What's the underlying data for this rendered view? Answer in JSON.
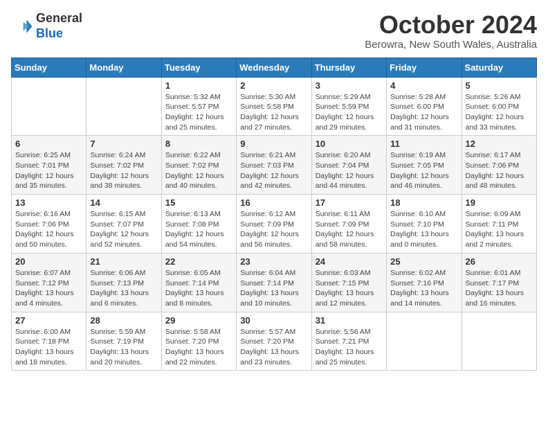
{
  "header": {
    "logo_general": "General",
    "logo_blue": "Blue",
    "title": "October 2024",
    "location": "Berowra, New South Wales, Australia"
  },
  "days_of_week": [
    "Sunday",
    "Monday",
    "Tuesday",
    "Wednesday",
    "Thursday",
    "Friday",
    "Saturday"
  ],
  "weeks": [
    [
      {
        "day": "",
        "info": ""
      },
      {
        "day": "",
        "info": ""
      },
      {
        "day": "1",
        "info": "Sunrise: 5:32 AM\nSunset: 5:57 PM\nDaylight: 12 hours\nand 25 minutes."
      },
      {
        "day": "2",
        "info": "Sunrise: 5:30 AM\nSunset: 5:58 PM\nDaylight: 12 hours\nand 27 minutes."
      },
      {
        "day": "3",
        "info": "Sunrise: 5:29 AM\nSunset: 5:59 PM\nDaylight: 12 hours\nand 29 minutes."
      },
      {
        "day": "4",
        "info": "Sunrise: 5:28 AM\nSunset: 6:00 PM\nDaylight: 12 hours\nand 31 minutes."
      },
      {
        "day": "5",
        "info": "Sunrise: 5:26 AM\nSunset: 6:00 PM\nDaylight: 12 hours\nand 33 minutes."
      }
    ],
    [
      {
        "day": "6",
        "info": "Sunrise: 6:25 AM\nSunset: 7:01 PM\nDaylight: 12 hours\nand 35 minutes."
      },
      {
        "day": "7",
        "info": "Sunrise: 6:24 AM\nSunset: 7:02 PM\nDaylight: 12 hours\nand 38 minutes."
      },
      {
        "day": "8",
        "info": "Sunrise: 6:22 AM\nSunset: 7:02 PM\nDaylight: 12 hours\nand 40 minutes."
      },
      {
        "day": "9",
        "info": "Sunrise: 6:21 AM\nSunset: 7:03 PM\nDaylight: 12 hours\nand 42 minutes."
      },
      {
        "day": "10",
        "info": "Sunrise: 6:20 AM\nSunset: 7:04 PM\nDaylight: 12 hours\nand 44 minutes."
      },
      {
        "day": "11",
        "info": "Sunrise: 6:19 AM\nSunset: 7:05 PM\nDaylight: 12 hours\nand 46 minutes."
      },
      {
        "day": "12",
        "info": "Sunrise: 6:17 AM\nSunset: 7:06 PM\nDaylight: 12 hours\nand 48 minutes."
      }
    ],
    [
      {
        "day": "13",
        "info": "Sunrise: 6:16 AM\nSunset: 7:06 PM\nDaylight: 12 hours\nand 50 minutes."
      },
      {
        "day": "14",
        "info": "Sunrise: 6:15 AM\nSunset: 7:07 PM\nDaylight: 12 hours\nand 52 minutes."
      },
      {
        "day": "15",
        "info": "Sunrise: 6:13 AM\nSunset: 7:08 PM\nDaylight: 12 hours\nand 54 minutes."
      },
      {
        "day": "16",
        "info": "Sunrise: 6:12 AM\nSunset: 7:09 PM\nDaylight: 12 hours\nand 56 minutes."
      },
      {
        "day": "17",
        "info": "Sunrise: 6:11 AM\nSunset: 7:09 PM\nDaylight: 12 hours\nand 58 minutes."
      },
      {
        "day": "18",
        "info": "Sunrise: 6:10 AM\nSunset: 7:10 PM\nDaylight: 13 hours\nand 0 minutes."
      },
      {
        "day": "19",
        "info": "Sunrise: 6:09 AM\nSunset: 7:11 PM\nDaylight: 13 hours\nand 2 minutes."
      }
    ],
    [
      {
        "day": "20",
        "info": "Sunrise: 6:07 AM\nSunset: 7:12 PM\nDaylight: 13 hours\nand 4 minutes."
      },
      {
        "day": "21",
        "info": "Sunrise: 6:06 AM\nSunset: 7:13 PM\nDaylight: 13 hours\nand 6 minutes."
      },
      {
        "day": "22",
        "info": "Sunrise: 6:05 AM\nSunset: 7:14 PM\nDaylight: 13 hours\nand 8 minutes."
      },
      {
        "day": "23",
        "info": "Sunrise: 6:04 AM\nSunset: 7:14 PM\nDaylight: 13 hours\nand 10 minutes."
      },
      {
        "day": "24",
        "info": "Sunrise: 6:03 AM\nSunset: 7:15 PM\nDaylight: 13 hours\nand 12 minutes."
      },
      {
        "day": "25",
        "info": "Sunrise: 6:02 AM\nSunset: 7:16 PM\nDaylight: 13 hours\nand 14 minutes."
      },
      {
        "day": "26",
        "info": "Sunrise: 6:01 AM\nSunset: 7:17 PM\nDaylight: 13 hours\nand 16 minutes."
      }
    ],
    [
      {
        "day": "27",
        "info": "Sunrise: 6:00 AM\nSunset: 7:18 PM\nDaylight: 13 hours\nand 18 minutes."
      },
      {
        "day": "28",
        "info": "Sunrise: 5:59 AM\nSunset: 7:19 PM\nDaylight: 13 hours\nand 20 minutes."
      },
      {
        "day": "29",
        "info": "Sunrise: 5:58 AM\nSunset: 7:20 PM\nDaylight: 13 hours\nand 22 minutes."
      },
      {
        "day": "30",
        "info": "Sunrise: 5:57 AM\nSunset: 7:20 PM\nDaylight: 13 hours\nand 23 minutes."
      },
      {
        "day": "31",
        "info": "Sunrise: 5:56 AM\nSunset: 7:21 PM\nDaylight: 13 hours\nand 25 minutes."
      },
      {
        "day": "",
        "info": ""
      },
      {
        "day": "",
        "info": ""
      }
    ]
  ]
}
